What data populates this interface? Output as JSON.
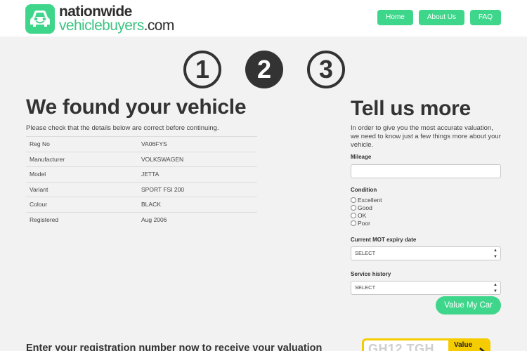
{
  "header": {
    "logo": {
      "line1": "nationwide",
      "line2": "vehiclebuyers",
      "tld": ".com"
    },
    "nav": [
      "Home",
      "About Us",
      "FAQ"
    ]
  },
  "steps": [
    "1",
    "2",
    "3"
  ],
  "found": {
    "title": "We found your vehicle",
    "intro": "Please check that the details below are correct before continuing.",
    "rows": [
      {
        "label": "Reg No",
        "value": "VA06FYS"
      },
      {
        "label": "Manufacturer",
        "value": "VOLKSWAGEN"
      },
      {
        "label": "Model",
        "value": "JETTA"
      },
      {
        "label": "Variant",
        "value": "SPORT FSI 200"
      },
      {
        "label": "Colour",
        "value": "BLACK"
      },
      {
        "label": "Registered",
        "value": "Aug 2006"
      }
    ]
  },
  "more": {
    "title": "Tell us more",
    "intro": "In order to give you the most accurate valuation, we need to know just a few things more about your vehicle.",
    "mileage_label": "Mileage",
    "condition_label": "Condition",
    "conditions": [
      "Excellent",
      "Good",
      "OK",
      "Poor"
    ],
    "mot_label": "Current MOT expiry date",
    "mot_value": "SELECT",
    "service_label": "Service history",
    "service_value": "SELECT",
    "submit": "Value My Car"
  },
  "footer": {
    "heading": "Enter your registration number now to receive your valuation",
    "plate_placeholder": "GH12 TGH",
    "plate_button": "Value"
  },
  "colors": {
    "accent": "#3ed68a",
    "dark": "#333333",
    "plate": "#f5cc00"
  }
}
